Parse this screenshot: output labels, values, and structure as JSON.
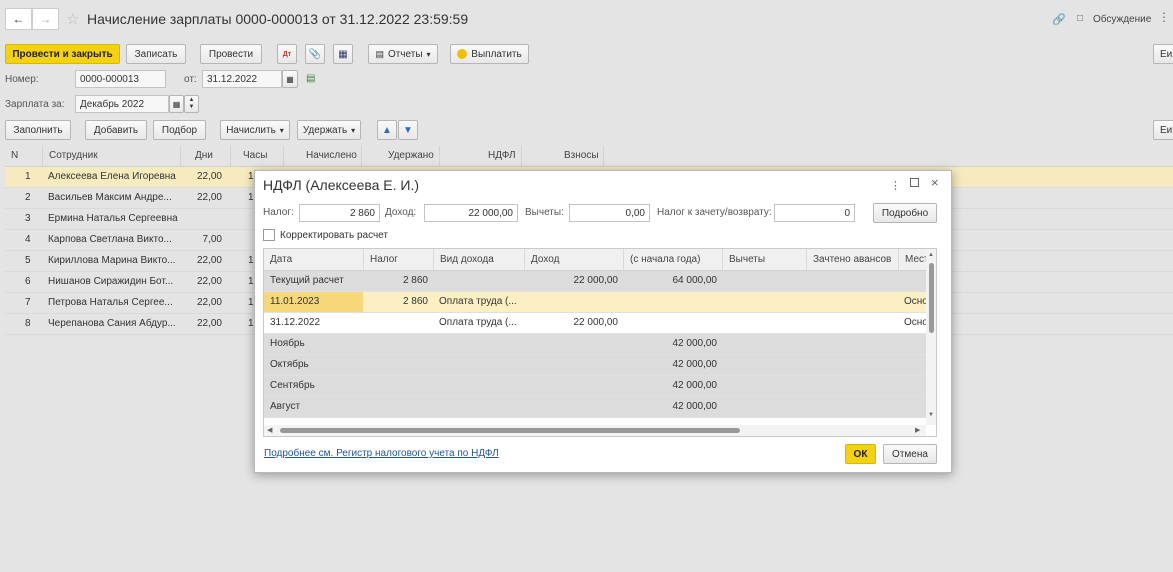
{
  "window": {
    "title": "Начисление зарплаты 0000-000013 от 31.12.2022 23:59:59",
    "discuss_label": "Обсуждение"
  },
  "toolbar": {
    "post_close": "Провести и закрыть",
    "save": "Записать",
    "post": "Провести",
    "reports": "Отчеты",
    "pay": "Выплатить",
    "more": "Еи"
  },
  "header": {
    "number_label": "Номер:",
    "number_value": "0000-000013",
    "date_label": "от:",
    "date_value": "31.12.2022",
    "period_label": "Зарплата за:",
    "period_value": "Декабрь 2022"
  },
  "table_toolbar": {
    "fill": "Заполнить",
    "add": "Добавить",
    "select": "Подбор",
    "accrue": "Начислить",
    "withhold": "Удержать",
    "more": "Еи"
  },
  "columns": [
    "N",
    "Сотрудник",
    "Дни",
    "Часы",
    "Начислено",
    "Удержано",
    "НДФЛ",
    "Взносы"
  ],
  "rows": [
    {
      "n": "1",
      "name": "Алексеева Елена Игоревна",
      "days": "22,00",
      "hours": "1"
    },
    {
      "n": "2",
      "name": "Васильев Максим Андре...",
      "days": "22,00",
      "hours": "1"
    },
    {
      "n": "3",
      "name": "Ермина Наталья Сергеевна",
      "days": "",
      "hours": ""
    },
    {
      "n": "4",
      "name": "Карпова Светлана Викто...",
      "days": "7,00",
      "hours": ""
    },
    {
      "n": "5",
      "name": "Кириллова Марина Викто...",
      "days": "22,00",
      "hours": "1"
    },
    {
      "n": "6",
      "name": "Нишанов Сиражидин Бот...",
      "days": "22,00",
      "hours": "1"
    },
    {
      "n": "7",
      "name": "Петрова Наталья Сергее...",
      "days": "22,00",
      "hours": "1"
    },
    {
      "n": "8",
      "name": "Черепанова Сания Абдур...",
      "days": "22,00",
      "hours": "1"
    }
  ],
  "dialog": {
    "title": "НДФЛ (Алексеева Е. И.)",
    "tax_label": "Налог:",
    "tax_value": "2 860",
    "income_label": "Доход:",
    "income_value": "22 000,00",
    "deductions_label": "Вычеты:",
    "deductions_value": "0,00",
    "offset_label": "Налог к зачету/возврату:",
    "offset_value": "0",
    "details_btn": "Подробно",
    "adjust_label": "Корректировать расчет",
    "columns": [
      "Дата",
      "Налог",
      "Вид дохода",
      "Доход",
      "(с начала года)",
      "Вычеты",
      "Зачтено авансов",
      "Мест"
    ],
    "rows": [
      {
        "date": "Текущий расчет",
        "tax": "2 860",
        "kind": "",
        "income": "22 000,00",
        "ytd": "64 000,00",
        "ded": "",
        "adv": "",
        "place": ""
      },
      {
        "date": "11.01.2023",
        "tax": "2 860",
        "kind": "Оплата труда (...",
        "income": "",
        "ytd": "",
        "ded": "",
        "adv": "",
        "place": "Осно"
      },
      {
        "date": "31.12.2022",
        "tax": "",
        "kind": "Оплата труда (...",
        "income": "22 000,00",
        "ytd": "",
        "ded": "",
        "adv": "",
        "place": "Осно"
      },
      {
        "date": "Ноябрь",
        "tax": "",
        "kind": "",
        "income": "",
        "ytd": "42 000,00",
        "ded": "",
        "adv": "",
        "place": ""
      },
      {
        "date": "Октябрь",
        "tax": "",
        "kind": "",
        "income": "",
        "ytd": "42 000,00",
        "ded": "",
        "adv": "",
        "place": ""
      },
      {
        "date": "Сентябрь",
        "tax": "",
        "kind": "",
        "income": "",
        "ytd": "42 000,00",
        "ded": "",
        "adv": "",
        "place": ""
      },
      {
        "date": "Август",
        "tax": "",
        "kind": "",
        "income": "",
        "ytd": "42 000,00",
        "ded": "",
        "adv": "",
        "place": ""
      }
    ],
    "link": "Подробнее см. Регистр налогового учета по НДФЛ",
    "ok": "ОК",
    "cancel": "Отмена"
  },
  "colors": {
    "accent": "#f5d20f",
    "selected_row": "#f6ebbf"
  }
}
